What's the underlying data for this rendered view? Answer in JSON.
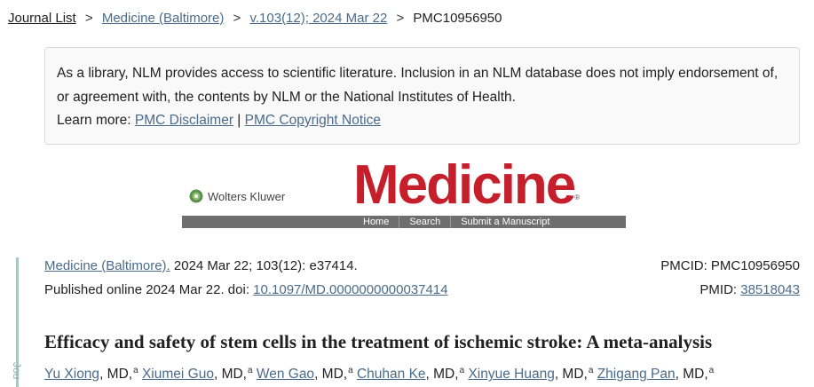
{
  "breadcrumb": {
    "items": [
      "Journal List",
      "Medicine (Baltimore)",
      "v.103(12); 2024 Mar 22",
      "PMC10956950"
    ],
    "separator": ">"
  },
  "disclaimer": {
    "text": "As a library, NLM provides access to scientific literature. Inclusion in an NLM database does not imply endorsement of, or agreement with, the contents by NLM or the National Institutes of Health.",
    "learn_more_label": "Learn more:",
    "link1": "PMC Disclaimer",
    "divider": "|",
    "link2": "PMC Copyright Notice"
  },
  "banner": {
    "publisher": "Wolters Kluwer",
    "journal_logo": "Medicine",
    "registered": "®",
    "nav": [
      "Home",
      "Search",
      "Submit a Manuscript"
    ]
  },
  "sidebar": {
    "label": "Jou"
  },
  "citation": {
    "journal": "Medicine (Baltimore).",
    "details": " 2024 Mar 22; 103(12): e37414.",
    "published_prefix": "Published online 2024 Mar 22. doi: ",
    "doi": "10.1097/MD.0000000000037414",
    "pmcid": "PMCID: PMC10956950",
    "pmid_label": "PMID: ",
    "pmid": "38518043"
  },
  "article": {
    "title": "Efficacy and safety of stem cells in the treatment of ischemic stroke: A meta-analysis",
    "authors": [
      {
        "name": "Yu Xiong",
        "degree": ", MD,",
        "aff": "a"
      },
      {
        "name": "Xiumei Guo",
        "degree": ", MD,",
        "aff": "a"
      },
      {
        "name": "Wen Gao",
        "degree": ", MD,",
        "aff": "a"
      },
      {
        "name": "Chuhan Ke",
        "degree": ", MD,",
        "aff": "a"
      },
      {
        "name": "Xinyue Huang",
        "degree": ", MD,",
        "aff": "a"
      },
      {
        "name": "Zhigang Pan",
        "degree": ", MD,",
        "aff": "a"
      }
    ]
  },
  "colors": {
    "link": "#4a6b8a",
    "logo_red": "#c61f2c",
    "nav_bar": "#6e6e6e",
    "side_rule": "#a7c8c0",
    "disclaimer_bg": "#f9f9f9"
  }
}
